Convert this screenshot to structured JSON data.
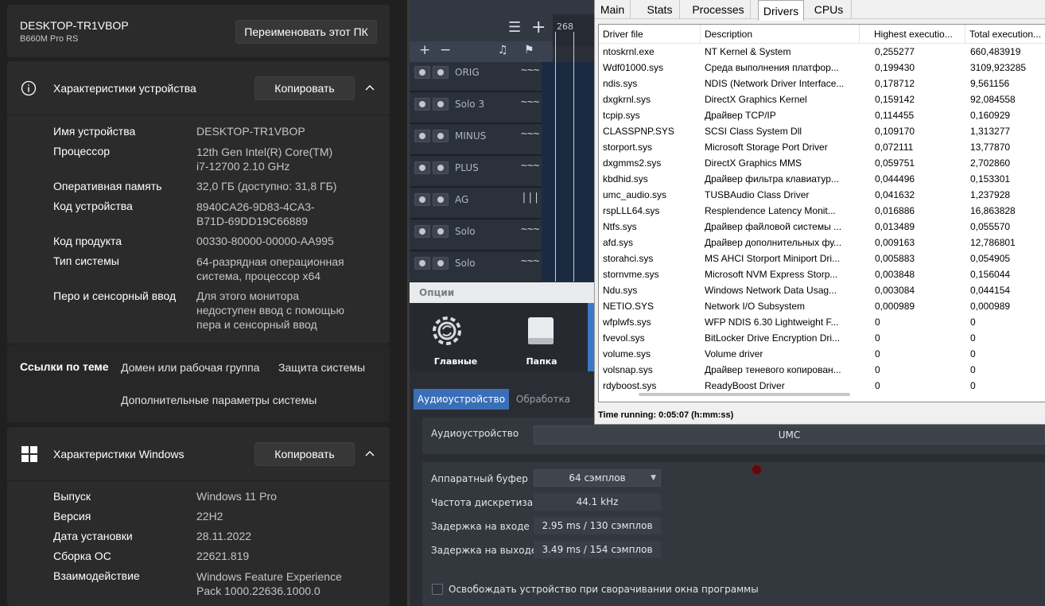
{
  "settings": {
    "device_name": "DESKTOP-TR1VBOP",
    "device_model": "B660M Pro RS",
    "rename_button": "Переименовать этот ПК",
    "spec_title": "Характеристики устройства",
    "copy_label": "Копировать",
    "spec_rows": [
      {
        "label": "Имя устройства",
        "value": "DESKTOP-TR1VBOP"
      },
      {
        "label": "Процессор",
        "value": "12th Gen Intel(R) Core(TM)",
        "value2": "i7-12700   2.10 GHz"
      },
      {
        "label": "Оперативная память",
        "value": "32,0 ГБ (доступно: 31,8 ГБ)"
      },
      {
        "label": "Код устройства",
        "value": "8940CA26-9D83-4CA3-",
        "value2": "B71D-69DD19C66889"
      },
      {
        "label": "Код продукта",
        "value": "00330-80000-00000-AA995"
      },
      {
        "label": "Тип системы",
        "value": "64-разрядная операционная",
        "value2": "система, процессор x64"
      },
      {
        "label": "Перо и сенсорный ввод",
        "value": "Для этого монитора",
        "value2": "недоступен ввод с помощью",
        "value3": "пера и сенсорный ввод"
      }
    ],
    "links_title": "Ссылки по теме",
    "link_domain": "Домен или рабочая группа",
    "link_protection": "Защита системы",
    "link_advanced": "Дополнительные параметры системы",
    "win_title": "Характеристики Windows",
    "win_rows": [
      {
        "label": "Выпуск",
        "value": "Windows 11 Pro"
      },
      {
        "label": "Версия",
        "value": "22H2"
      },
      {
        "label": "Дата установки",
        "value": "28.11.2022"
      },
      {
        "label": "Сборка ОС",
        "value": "22621.819"
      },
      {
        "label": "Взаимодействие",
        "value": "Windows Feature Experience",
        "value2": "Pack 1000.22636.1000.0"
      }
    ]
  },
  "daw": {
    "ruler_number": "268",
    "tracks": [
      {
        "name": "ORIG",
        "icon": "~~~"
      },
      {
        "name": "Solo 3",
        "icon": "~~~"
      },
      {
        "name": "MINUS",
        "icon": "~~~"
      },
      {
        "name": "PLUS",
        "icon": "~~~"
      },
      {
        "name": "AG",
        "icon": "|||"
      },
      {
        "name": "Solo",
        "icon": "~~~"
      },
      {
        "name": "Solo",
        "icon": "~~~"
      }
    ]
  },
  "options": {
    "title": "Опции",
    "tile_main": "Главные",
    "tile_folder": "Папка",
    "tab_audio": "Аудиоустройство",
    "tab_processing": "Обработка",
    "audio_device_label": "Аудиоустройство",
    "audio_device_value": "UMC",
    "buffer_label": "Аппаратный буфер",
    "buffer_value": "64 сэмплов",
    "samplerate_label": "Частота дискретизац",
    "samplerate_value": "44.1 kHz",
    "input_latency_label": "Задержка на входе",
    "input_latency_value": "2.95 ms / 130 сэмплов",
    "output_latency_label": "Задержка на выходе",
    "output_latency_value": "3.49 ms / 154 сэмплов",
    "release_label": "Освобождать устройство при сворачивании окна программы"
  },
  "latencymon": {
    "tabs": [
      "Main",
      "Stats",
      "Processes",
      "Drivers",
      "CPUs"
    ],
    "active_tab": "Drivers",
    "columns": [
      "Driver file",
      "Description",
      "Highest executio...",
      "Total execution..."
    ],
    "rows": [
      [
        "ntoskrnl.exe",
        "NT Kernel & System",
        "0,255277",
        "660,483919"
      ],
      [
        "Wdf01000.sys",
        "Среда выполнения платфор...",
        "0,199430",
        "3109,923285"
      ],
      [
        "ndis.sys",
        "NDIS (Network Driver Interface...",
        "0,178712",
        "9,561156"
      ],
      [
        "dxgkrnl.sys",
        "DirectX Graphics Kernel",
        "0,159142",
        "92,084558"
      ],
      [
        "tcpip.sys",
        "Драйвер TCP/IP",
        "0,114455",
        "0,160929"
      ],
      [
        "CLASSPNP.SYS",
        "SCSI Class System Dll",
        "0,109170",
        "1,313277"
      ],
      [
        "storport.sys",
        "Microsoft Storage Port Driver",
        "0,072111",
        "13,77870"
      ],
      [
        "dxgmms2.sys",
        "DirectX Graphics MMS",
        "0,059751",
        "2,702860"
      ],
      [
        "kbdhid.sys",
        "Драйвер фильтра клавиатур...",
        "0,044496",
        "0,153301"
      ],
      [
        "umc_audio.sys",
        "TUSBAudio Class Driver",
        "0,041632",
        "1,237928"
      ],
      [
        "rspLLL64.sys",
        "Resplendence Latency Monit...",
        "0,016886",
        "16,863828"
      ],
      [
        "Ntfs.sys",
        "Драйвер файловой системы ...",
        "0,013489",
        "0,055570"
      ],
      [
        "afd.sys",
        "Драйвер дополнительных фу...",
        "0,009163",
        "12,786801"
      ],
      [
        "storahci.sys",
        "MS AHCI Storport Miniport Dri...",
        "0,005883",
        "0,054905"
      ],
      [
        "stornvme.sys",
        "Microsoft NVM Express Storp...",
        "0,003848",
        "0,156044"
      ],
      [
        "Ndu.sys",
        "Windows Network Data Usag...",
        "0,003084",
        "0,044154"
      ],
      [
        "NETIO.SYS",
        "Network I/O Subsystem",
        "0,000989",
        "0,000989"
      ],
      [
        "wfplwfs.sys",
        "WFP NDIS 6.30 Lightweight F...",
        "0",
        "0"
      ],
      [
        "fvevol.sys",
        "BitLocker Drive Encryption Dri...",
        "0",
        "0"
      ],
      [
        "volume.sys",
        "Volume driver",
        "0",
        "0"
      ],
      [
        "volsnap.sys",
        "Драйвер теневого копирован...",
        "0",
        "0"
      ],
      [
        "rdyboost.sys",
        "ReadyBoost Driver",
        "0",
        "0"
      ]
    ],
    "status": "Time running: 0:05:07  (h:mm:ss)"
  }
}
